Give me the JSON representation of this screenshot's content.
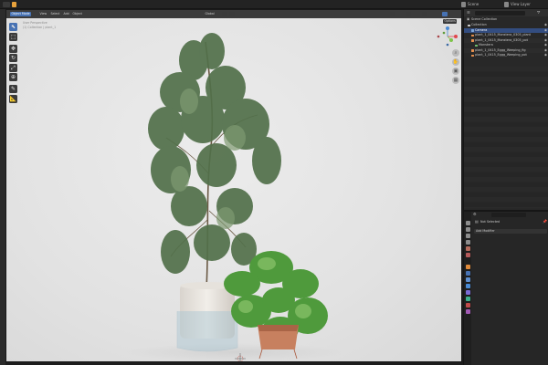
{
  "topbar": {
    "scene_name": "Scene",
    "view_layer_name": "View Layer"
  },
  "viewport": {
    "mode_label": "Object Mode",
    "menus": [
      "View",
      "Select",
      "Add",
      "Object"
    ],
    "transform_label": "Global",
    "options_label": "Options",
    "overlay_lines": [
      "User Perspective",
      "(1) Collection | plant_1"
    ],
    "tools": [
      {
        "icon": "cursor-icon",
        "glyph": "⬉"
      },
      {
        "icon": "select-box-icon",
        "glyph": "⬚"
      },
      {
        "icon": "move-icon",
        "glyph": "✥"
      },
      {
        "icon": "rotate-icon",
        "glyph": "↻"
      },
      {
        "icon": "scale-icon",
        "glyph": "⤢"
      },
      {
        "icon": "transform-icon",
        "glyph": "⊕"
      },
      {
        "icon": "annotate-icon",
        "glyph": "✎"
      },
      {
        "icon": "measure-icon",
        "glyph": "📐"
      }
    ]
  },
  "outliner": {
    "title": "Scene Collection",
    "rows": [
      {
        "label": "Collection",
        "indent": 4,
        "color": "#cfcfcf",
        "selected": false
      },
      {
        "label": "Camera",
        "indent": 8,
        "color": "#7aa4d6",
        "selected": true
      },
      {
        "label": "plant_1_0415_Monstera_0305_plant",
        "indent": 8,
        "color": "#e38f4e",
        "selected": false
      },
      {
        "label": "plant_1_0415_Monstera_0305_pot",
        "indent": 8,
        "color": "#e38f4e",
        "selected": false
      },
      {
        "label": "Monstera",
        "indent": 12,
        "color": "#6fbf6f",
        "selected": false
      },
      {
        "label": "plant_1_0415_Eggg_Weeping_fig",
        "indent": 8,
        "color": "#e38f4e",
        "selected": false
      },
      {
        "label": "plant_1_0415_Eggg_Weeping_pot",
        "indent": 8,
        "color": "#e38f4e",
        "selected": false
      }
    ]
  },
  "properties": {
    "search_placeholder": "",
    "object_name": "Not Selected",
    "modifier_label": "Add Modifier"
  },
  "colors": {
    "accent": "#4772b3",
    "axis_x": "#e0474c",
    "axis_y": "#7ec44a",
    "axis_z": "#4a8bd6"
  }
}
